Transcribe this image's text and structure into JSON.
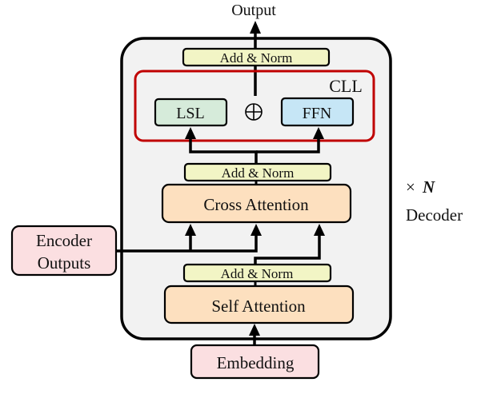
{
  "diagram": {
    "output_label": "Output",
    "decoder_block": {
      "repeat_label": "×",
      "repeat_symbol": "N",
      "name_label": "Decoder"
    },
    "top_add_norm": "Add & Norm",
    "cll": {
      "label": "CLL",
      "lsl_label": "LSL",
      "ffn_label": "FFN",
      "combine_symbol": "⊕"
    },
    "middle_add_norm": "Add & Norm",
    "cross_attention": "Cross Attention",
    "encoder_outputs": [
      "Encoder",
      "Outputs"
    ],
    "bottom_add_norm": "Add & Norm",
    "self_attention": "Self Attention",
    "embedding": "Embedding",
    "colors": {
      "add_norm_fill": "#f2f5c5",
      "attention_fill": "#fde0bf",
      "lsl_fill": "#d6ebda",
      "ffn_fill": "#c6e6f6",
      "pink_fill": "#fbdfe1",
      "decoder_fill": "#f2f2f2",
      "cll_border": "#c00000"
    }
  }
}
